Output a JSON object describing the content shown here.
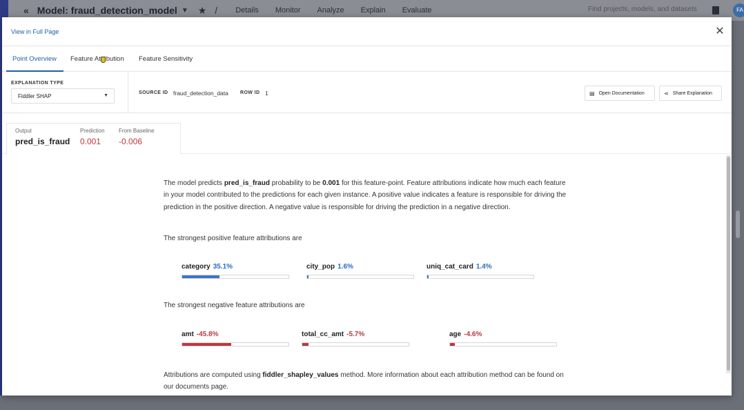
{
  "app": {
    "model_prefix": "Model:",
    "model_name": "fraud_detection_model",
    "nav_tabs": [
      "Details",
      "Monitor",
      "Analyze",
      "Explain",
      "Evaluate"
    ],
    "search_placeholder": "Find projects, models, and datasets",
    "avatar_initials": "FA"
  },
  "modal": {
    "view_full_page": "View in Full Page",
    "tabs": [
      {
        "label": "Point Overview",
        "active": true
      },
      {
        "label": "Feature Attribution",
        "active": false
      },
      {
        "label": "Feature Sensitivity",
        "active": false
      }
    ],
    "explanation_type_label": "EXPLANATION TYPE",
    "explanation_type_value": "Fiddler SHAP",
    "source_id_label": "SOURCE ID",
    "source_id_value": "fraud_detection_data",
    "row_id_label": "ROW ID",
    "row_id_value": "1",
    "open_documentation": "Open Documentation",
    "share_explanation": "Share Explanation",
    "summary": {
      "output_label": "Output",
      "output_value": "pred_is_fraud",
      "prediction_label": "Prediction",
      "prediction_value": "0.001",
      "baseline_label": "From Baseline",
      "baseline_value": "-0.006"
    },
    "explanation": {
      "p1_a": "The model predicts ",
      "p1_b": "pred_is_fraud",
      "p1_c": " probability to be ",
      "p1_d": "0.001",
      "p1_e": " for this feature-point. Feature attributions indicate how much each feature in your model contributed to the predictions for each given instance. A positive value indicates a feature is responsible for driving the prediction in the positive direction. A negative value is responsible for driving the prediction in a negative direction.",
      "positive_title": "The strongest positive feature attributions are",
      "negative_title": "The strongest negative feature attributions are",
      "footer_a": "Attributions are computed using ",
      "footer_b": "fiddler_shapley_values",
      "footer_c": " method. More information about each attribution method can be found on our documents page."
    },
    "positive_features": [
      {
        "name": "category",
        "pct": "35.1%",
        "value": 35.1
      },
      {
        "name": "city_pop",
        "pct": "1.6%",
        "value": 1.6
      },
      {
        "name": "uniq_cat_card",
        "pct": "1.4%",
        "value": 1.4
      }
    ],
    "negative_features": [
      {
        "name": "amt",
        "pct": "-45.8%",
        "value": 45.8
      },
      {
        "name": "total_cc_amt",
        "pct": "-5.7%",
        "value": 5.7
      },
      {
        "name": "age",
        "pct": "-4.6%",
        "value": 4.6
      }
    ],
    "colors": {
      "accent": "#1f5fa8",
      "positive": "#3a74c9",
      "negative": "#c0373e"
    }
  }
}
